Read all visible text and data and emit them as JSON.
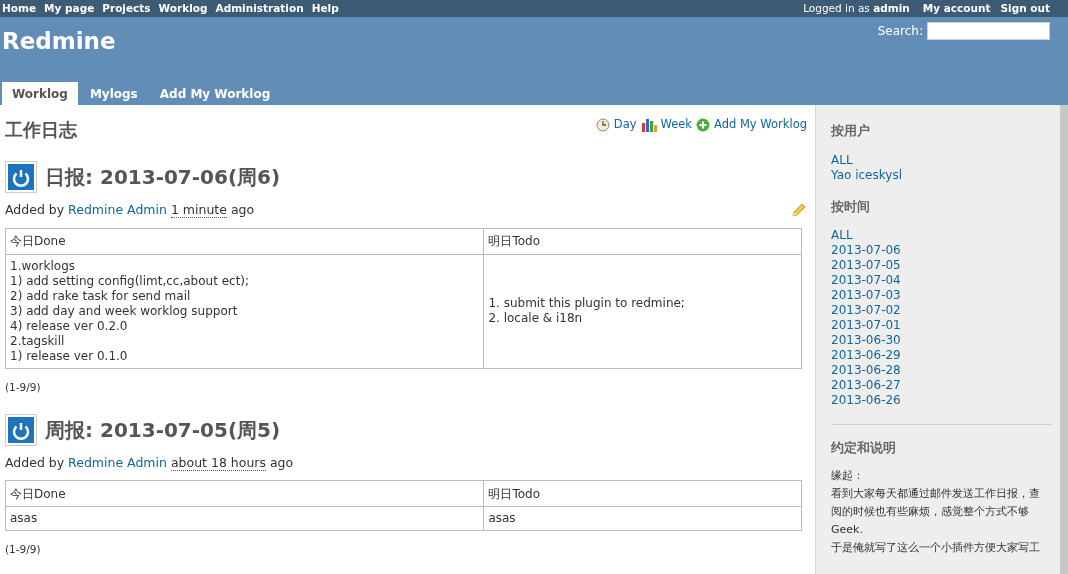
{
  "top_menu": [
    "Home",
    "My page",
    "Projects",
    "Worklog",
    "Administration",
    "Help"
  ],
  "account": {
    "logged_in": "Logged in as **admin**",
    "links": [
      "My account",
      "Sign out"
    ]
  },
  "header": {
    "title": "Redmine",
    "search_label": "Search:"
  },
  "tabs": [
    {
      "label": "Worklog",
      "selected": true
    },
    {
      "label": "Mylogs",
      "selected": false
    },
    {
      "label": "Add My Worklog",
      "selected": false
    }
  ],
  "main": {
    "title": "工作日志",
    "actions": [
      {
        "label": "Day",
        "kind": "clock"
      },
      {
        "label": "Week",
        "kind": "chart"
      },
      {
        "label": "Add My Worklog",
        "kind": "add"
      }
    ]
  },
  "entries": [
    {
      "title": "日报: 2013-07-06(周6)",
      "added_by": "Added by",
      "author": "Redmine Admin",
      "time": "1 minute",
      "ago": "ago",
      "editable": true,
      "columns": [
        "今日Done",
        "明日Todo"
      ],
      "cells": [
        [
          "1.worklogs",
          "1) add setting config(limt,cc,about ect);",
          "2) add rake task for send mail",
          "3) add day and week worklog support",
          "4) release ver 0.2.0",
          "2.tagskill",
          "1) release ver 0.1.0"
        ],
        [
          "1. submit this plugin to redmine;",
          "2. locale & i18n"
        ]
      ],
      "pagination": "(1-9/9)"
    },
    {
      "title": "周报: 2013-07-05(周5)",
      "added_by": "Added by",
      "author": "Redmine Admin",
      "time": "about 18 hours",
      "ago": "ago",
      "editable": false,
      "columns": [
        "今日Done",
        "明日Todo"
      ],
      "cells": [
        [
          "asas"
        ],
        [
          "asas"
        ]
      ],
      "pagination": "(1-9/9)"
    }
  ],
  "sidebar": {
    "sections": [
      {
        "kind": "links",
        "title": "按用户",
        "links": [
          "ALL",
          "Yao iceskysl"
        ]
      },
      {
        "kind": "links",
        "title": "按时间",
        "links": [
          "ALL",
          "2013-07-06",
          "2013-07-05",
          "2013-07-04",
          "2013-07-03",
          "2013-07-02",
          "2013-07-01",
          "2013-06-30",
          "2013-06-29",
          "2013-06-28",
          "2013-06-27",
          "2013-06-26"
        ]
      },
      {
        "kind": "note",
        "title": "约定和说明",
        "lines": [
          "缘起：",
          "看到大家每天都通过邮件发送工作日报，查",
          "阅的时候也有些麻烦，感觉整个方式不够",
          "Geek.",
          "于是俺就写了这么一个小插件方便大家写工"
        ]
      }
    ]
  }
}
